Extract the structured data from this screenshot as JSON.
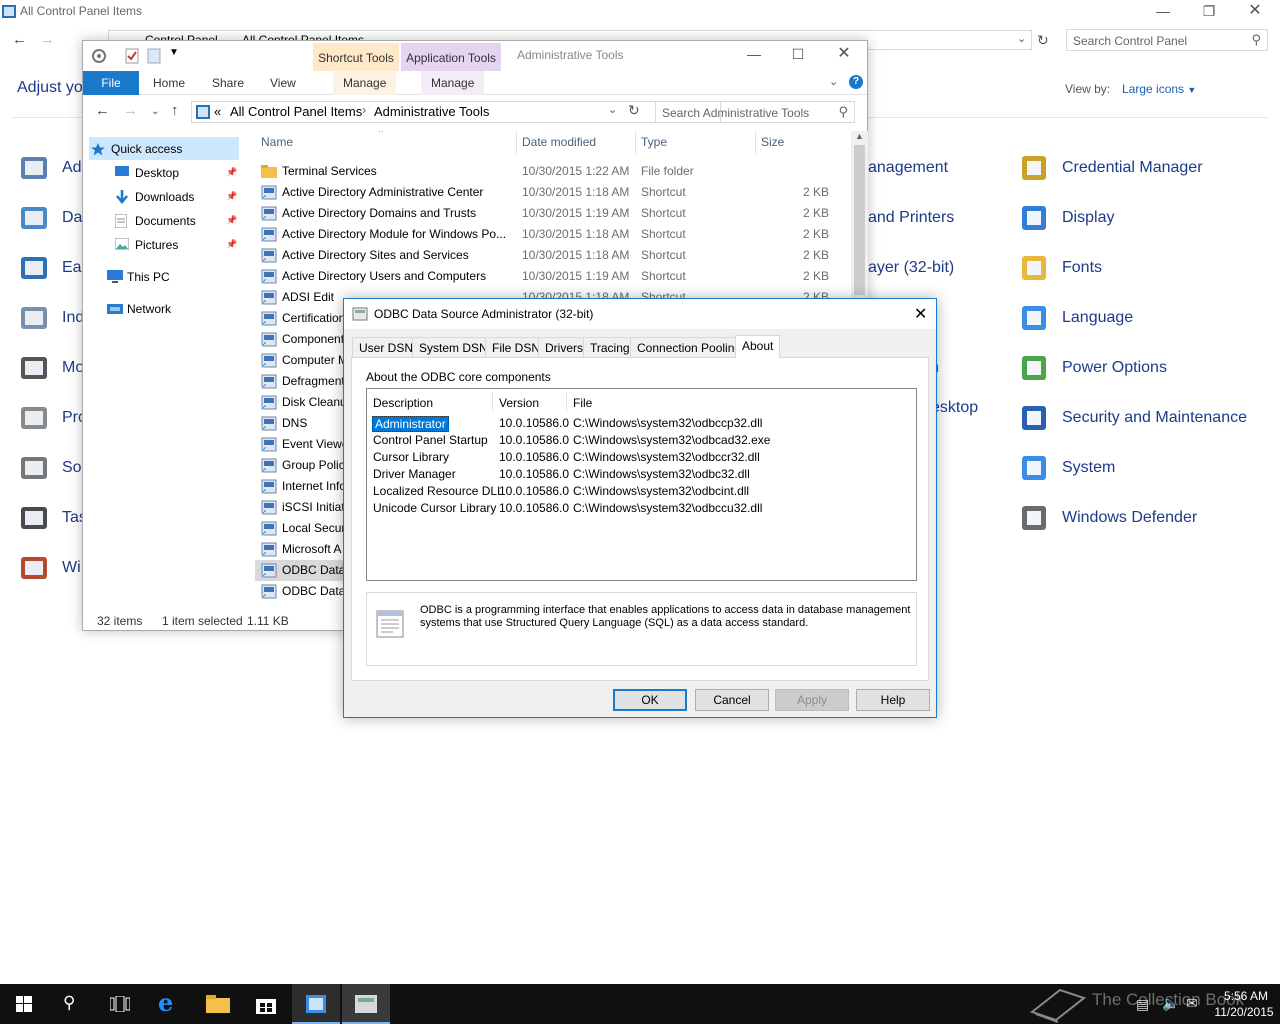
{
  "control_panel": {
    "title": "All Control Panel Items",
    "breadcrumb_1": "Control Panel",
    "breadcrumb_2": "All Control Panel Items",
    "search_placeholder": "Search Control Panel",
    "adjust_partial": "Adjust yo",
    "view_by_label": "View by:",
    "view_by_value": "Large icons",
    "left_items": [
      "Ad",
      "Dat",
      "Eas",
      "Ind",
      "Mo",
      "Pro",
      "Sou",
      "Tas",
      "Wi"
    ],
    "middle_partials": [
      "anagement",
      "and Printers",
      "ayer (32-bit)",
      "n",
      "esktop"
    ],
    "right_items": [
      "Credential Manager",
      "Display",
      "Fonts",
      "Language",
      "Power Options",
      "Security and Maintenance",
      "System",
      "Windows Defender"
    ]
  },
  "explorer": {
    "ribbon_context_1": "Shortcut Tools",
    "ribbon_context_2": "Application Tools",
    "window_title": "Administrative Tools",
    "tab_file": "File",
    "tab_home": "Home",
    "tab_share": "Share",
    "tab_view": "View",
    "tab_manage_1": "Manage",
    "tab_manage_2": "Manage",
    "address_prefix": "«",
    "address_1": "All Control Panel Items",
    "address_2": "Administrative Tools",
    "search_placeholder": "Search Administrative Tools",
    "sidebar": [
      {
        "label": "Quick access"
      },
      {
        "label": "Desktop"
      },
      {
        "label": "Downloads"
      },
      {
        "label": "Documents"
      },
      {
        "label": "Pictures"
      },
      {
        "label": "This PC"
      },
      {
        "label": "Network"
      }
    ],
    "columns": [
      "Name",
      "Date modified",
      "Type",
      "Size"
    ],
    "rows": [
      {
        "name": "Terminal Services",
        "date": "10/30/2015 1:22 AM",
        "type": "File folder",
        "size": ""
      },
      {
        "name": "Active Directory Administrative Center",
        "date": "10/30/2015 1:18 AM",
        "type": "Shortcut",
        "size": "2 KB"
      },
      {
        "name": "Active Directory Domains and Trusts",
        "date": "10/30/2015 1:19 AM",
        "type": "Shortcut",
        "size": "2 KB"
      },
      {
        "name": "Active Directory Module for Windows Po...",
        "date": "10/30/2015 1:18 AM",
        "type": "Shortcut",
        "size": "2 KB"
      },
      {
        "name": "Active Directory Sites and Services",
        "date": "10/30/2015 1:18 AM",
        "type": "Shortcut",
        "size": "2 KB"
      },
      {
        "name": "Active Directory Users and Computers",
        "date": "10/30/2015 1:19 AM",
        "type": "Shortcut",
        "size": "2 KB"
      },
      {
        "name": "ADSI Edit",
        "date": "10/30/2015 1:18 AM",
        "type": "Shortcut",
        "size": "2 KB"
      },
      {
        "name": "Certification",
        "date": "",
        "type": "",
        "size": ""
      },
      {
        "name": "Component",
        "date": "",
        "type": "",
        "size": ""
      },
      {
        "name": "Computer M",
        "date": "",
        "type": "",
        "size": ""
      },
      {
        "name": "Defragment",
        "date": "",
        "type": "",
        "size": ""
      },
      {
        "name": "Disk Cleanu",
        "date": "",
        "type": "",
        "size": ""
      },
      {
        "name": "DNS",
        "date": "",
        "type": "",
        "size": ""
      },
      {
        "name": "Event Viewe",
        "date": "",
        "type": "",
        "size": ""
      },
      {
        "name": "Group Polic",
        "date": "",
        "type": "",
        "size": ""
      },
      {
        "name": "Internet Info",
        "date": "",
        "type": "",
        "size": ""
      },
      {
        "name": "iSCSI Initiato",
        "date": "",
        "type": "",
        "size": ""
      },
      {
        "name": "Local Securi",
        "date": "",
        "type": "",
        "size": ""
      },
      {
        "name": "Microsoft A",
        "date": "",
        "type": "",
        "size": ""
      },
      {
        "name": "ODBC Data",
        "date": "",
        "type": "",
        "size": ""
      },
      {
        "name": "ODBC Data",
        "date": "",
        "type": "",
        "size": ""
      }
    ],
    "status_count": "32 items",
    "status_selected": "1 item selected",
    "status_size": "1.11 KB"
  },
  "dialog": {
    "title": "ODBC Data Source Administrator (32-bit)",
    "tabs": [
      "User DSN",
      "System DSN",
      "File DSN",
      "Drivers",
      "Tracing",
      "Connection Pooling",
      "About"
    ],
    "section_label": "About the ODBC core components",
    "columns": [
      "Description",
      "Version",
      "File"
    ],
    "components": [
      {
        "desc": "Administrator",
        "version": "10.0.10586.0",
        "file": "C:\\Windows\\system32\\odbccp32.dll"
      },
      {
        "desc": "Control Panel Startup",
        "version": "10.0.10586.0",
        "file": "C:\\Windows\\system32\\odbcad32.exe"
      },
      {
        "desc": "Cursor Library",
        "version": "10.0.10586.0",
        "file": "C:\\Windows\\system32\\odbccr32.dll"
      },
      {
        "desc": "Driver Manager",
        "version": "10.0.10586.0",
        "file": "C:\\Windows\\system32\\odbc32.dll"
      },
      {
        "desc": "Localized Resource DLL",
        "version": "10.0.10586.0",
        "file": "C:\\Windows\\system32\\odbcint.dll"
      },
      {
        "desc": "Unicode Cursor Library",
        "version": "10.0.10586.0",
        "file": "C:\\Windows\\system32\\odbccu32.dll"
      }
    ],
    "info_line_1": "ODBC is a programming interface that enables applications to access data in database management",
    "info_line_2": "systems that use Structured Query Language (SQL) as a data access standard.",
    "btn_ok": "OK",
    "btn_cancel": "Cancel",
    "btn_apply": "Apply",
    "btn_help": "Help"
  },
  "taskbar": {
    "time": "5:56 AM",
    "date": "11/20/2015",
    "watermark": "The Collection Book"
  },
  "colors": {
    "accent": "#1979ca",
    "link": "#1e3a8a",
    "taskbar": "#101010"
  }
}
